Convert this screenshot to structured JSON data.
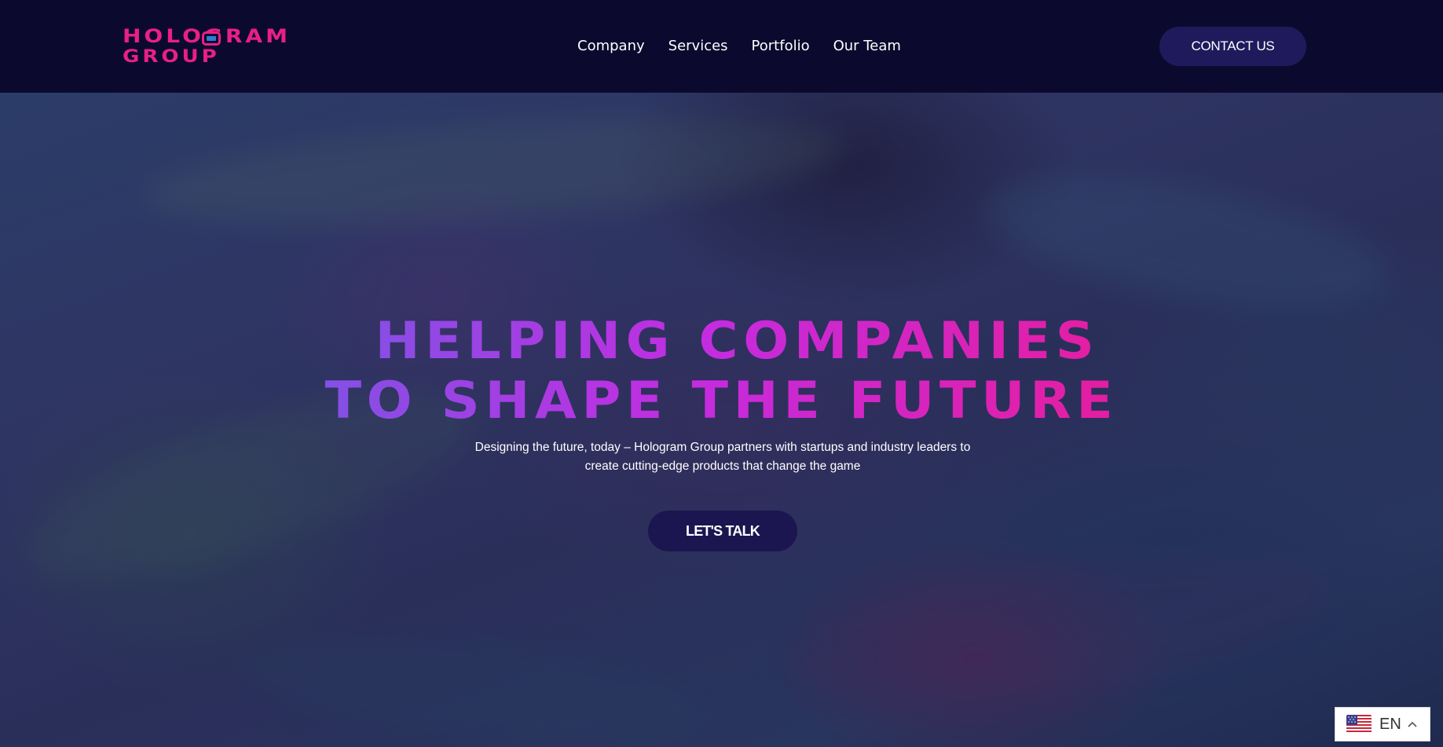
{
  "header": {
    "logo": {
      "line1": "HOLOGRAM",
      "line2": "GROUP",
      "color": "#ea1f86"
    },
    "nav": [
      {
        "label": "Company"
      },
      {
        "label": "Services"
      },
      {
        "label": "Portfolio"
      },
      {
        "label": "Our Team"
      }
    ],
    "contact_label": "CONTACT US"
  },
  "hero": {
    "title_line1": "HELPING COMPANIES",
    "title_line2": "TO SHAPE THE FUTURE",
    "title_gradient": [
      "#3e8ee6",
      "#7b55e6",
      "#c42ce0",
      "#e21fa6",
      "#e0186e"
    ],
    "subtitle_line1": "Designing the future, today – Hologram Group partners with startups and industry leaders to",
    "subtitle_line2": "create cutting-edge products that change the game",
    "cta_label": "LET'S TALK"
  },
  "language_switcher": {
    "code": "EN",
    "flag": "us-flag-icon"
  },
  "colors": {
    "header_bg": "#0b0a2e",
    "button_bg": "#1f1a5c",
    "accent": "#ea1f86"
  }
}
